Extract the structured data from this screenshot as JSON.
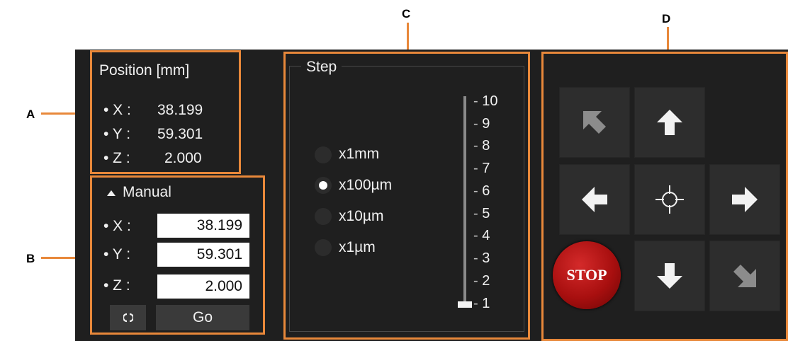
{
  "callouts": {
    "a": "A",
    "b": "B",
    "c": "C",
    "d": "D"
  },
  "position": {
    "title": "Position [mm]",
    "x_label": "• X :",
    "x_value": "38.199",
    "y_label": "• Y :",
    "y_value": "59.301",
    "z_label": "• Z :",
    "z_value": "2.000"
  },
  "manual": {
    "title": "Manual",
    "x_label": "• X :",
    "x_value": "38.199",
    "y_label": "• Y :",
    "y_value": "59.301",
    "z_label": "• Z :",
    "z_value": "2.000",
    "go_label": "Go"
  },
  "step": {
    "title": "Step",
    "options": [
      {
        "label": "x1mm",
        "selected": false
      },
      {
        "label": "x100µm",
        "selected": true
      },
      {
        "label": "x10µm",
        "selected": false
      },
      {
        "label": "x1µm",
        "selected": false
      }
    ],
    "slider_ticks": [
      "10",
      "9",
      "8",
      "7",
      "6",
      "5",
      "4",
      "3",
      "2",
      "1"
    ],
    "slider_value": 1
  },
  "jog": {
    "stop_label": "STOP"
  },
  "colors": {
    "accent_outline": "#e8883a",
    "panel_bg": "#1f1f1f",
    "stop_red": "#b01212"
  }
}
